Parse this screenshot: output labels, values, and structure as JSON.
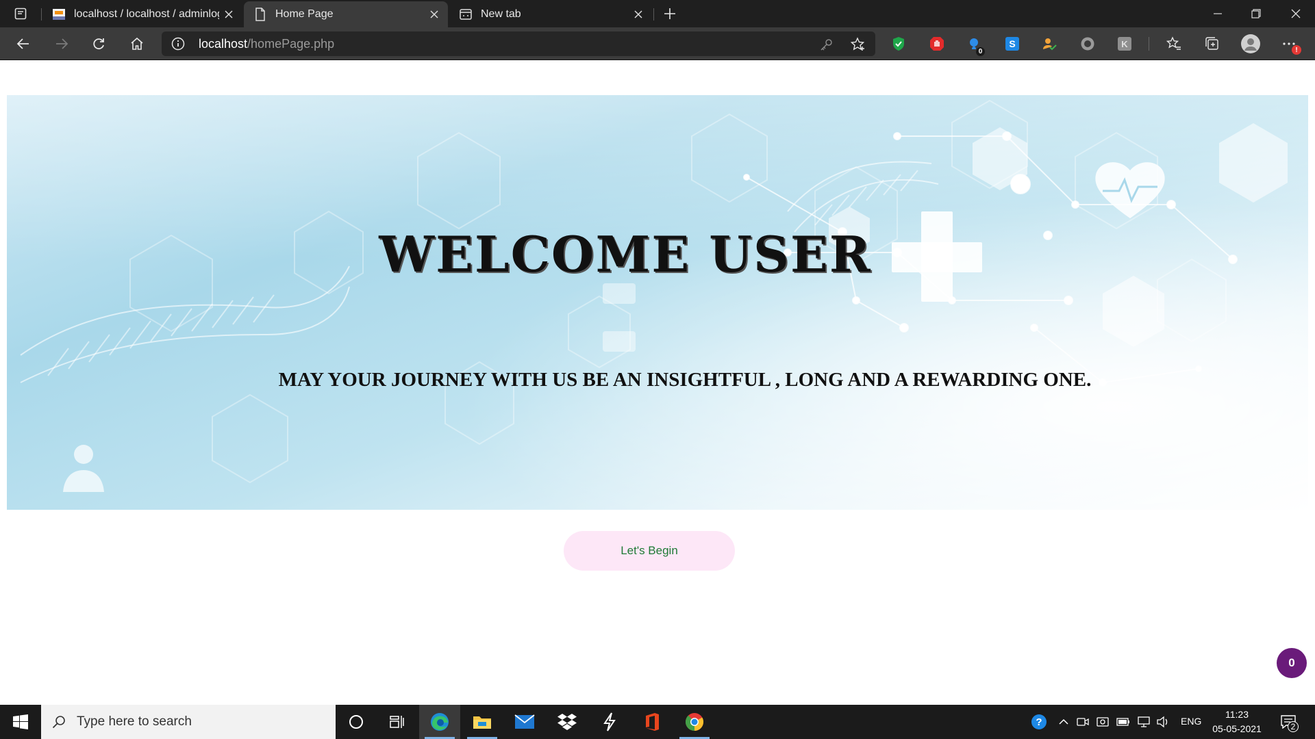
{
  "browser": {
    "tabs": [
      {
        "title": "localhost / localhost / adminlogi",
        "favicon": "phpmyadmin-icon",
        "active": false
      },
      {
        "title": "Home Page",
        "favicon": "page-icon",
        "active": true
      },
      {
        "title": "New tab",
        "favicon": "newtab-icon",
        "active": false
      }
    ],
    "address": {
      "host": "localhost",
      "path": "/homePage.php"
    },
    "extension_badges": {
      "shield_count": "0",
      "profile_alert": "!"
    }
  },
  "page": {
    "welcome_title": "WELCOME USER",
    "tagline": "MAY YOUR JOURNEY WITH US BE AN INSIGHTFUL , LONG AND A REWARDING ONE.",
    "begin_button": "Let's Begin",
    "cart_count": "0",
    "colors": {
      "hero_blue": "#a9d8ea",
      "button_bg": "#fde7f7",
      "button_text": "#1f7a36",
      "cart_bubble": "#6a1b7a"
    }
  },
  "taskbar": {
    "search_placeholder": "Type here to search",
    "language": "ENG",
    "time": "11:23",
    "date": "05-05-2021",
    "notification_count": "2"
  }
}
